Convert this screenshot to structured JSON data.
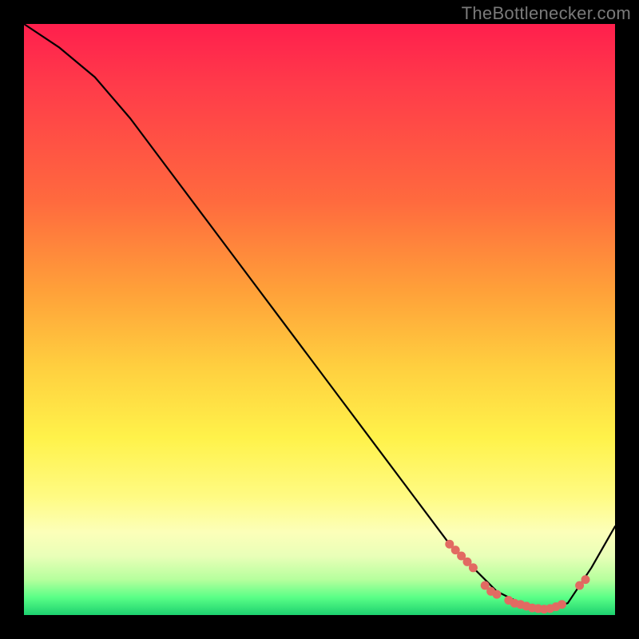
{
  "watermark": "TheBottlenecker.com",
  "colors": {
    "gradient_top": "#ff1f4d",
    "gradient_mid": "#ffe94a",
    "gradient_bottom": "#1dd16f",
    "curve": "#000000",
    "dots": "#e26a62",
    "frame_bg": "#000000"
  },
  "chart_data": {
    "type": "line",
    "title": "",
    "xlabel": "",
    "ylabel": "",
    "xlim": [
      0,
      100
    ],
    "ylim": [
      0,
      100
    ],
    "series": [
      {
        "name": "bottleneck-curve",
        "x": [
          0,
          6,
          12,
          18,
          24,
          30,
          36,
          42,
          48,
          54,
          60,
          66,
          72,
          76,
          80,
          84,
          88,
          92,
          96,
          100
        ],
        "y": [
          100,
          96,
          91,
          84,
          76,
          68,
          60,
          52,
          44,
          36,
          28,
          20,
          12,
          8,
          4,
          2,
          1,
          2,
          8,
          15
        ]
      }
    ],
    "highlight_dots": {
      "name": "optimal-region",
      "points": [
        {
          "x": 72,
          "y": 12
        },
        {
          "x": 73,
          "y": 11
        },
        {
          "x": 74,
          "y": 10
        },
        {
          "x": 75,
          "y": 9
        },
        {
          "x": 76,
          "y": 8
        },
        {
          "x": 78,
          "y": 5
        },
        {
          "x": 79,
          "y": 4
        },
        {
          "x": 80,
          "y": 3.5
        },
        {
          "x": 82,
          "y": 2.5
        },
        {
          "x": 83,
          "y": 2
        },
        {
          "x": 84,
          "y": 1.8
        },
        {
          "x": 85,
          "y": 1.5
        },
        {
          "x": 86,
          "y": 1.2
        },
        {
          "x": 87,
          "y": 1.1
        },
        {
          "x": 88,
          "y": 1.0
        },
        {
          "x": 89,
          "y": 1.1
        },
        {
          "x": 90,
          "y": 1.4
        },
        {
          "x": 91,
          "y": 1.8
        },
        {
          "x": 94,
          "y": 5
        },
        {
          "x": 95,
          "y": 6
        }
      ]
    }
  }
}
